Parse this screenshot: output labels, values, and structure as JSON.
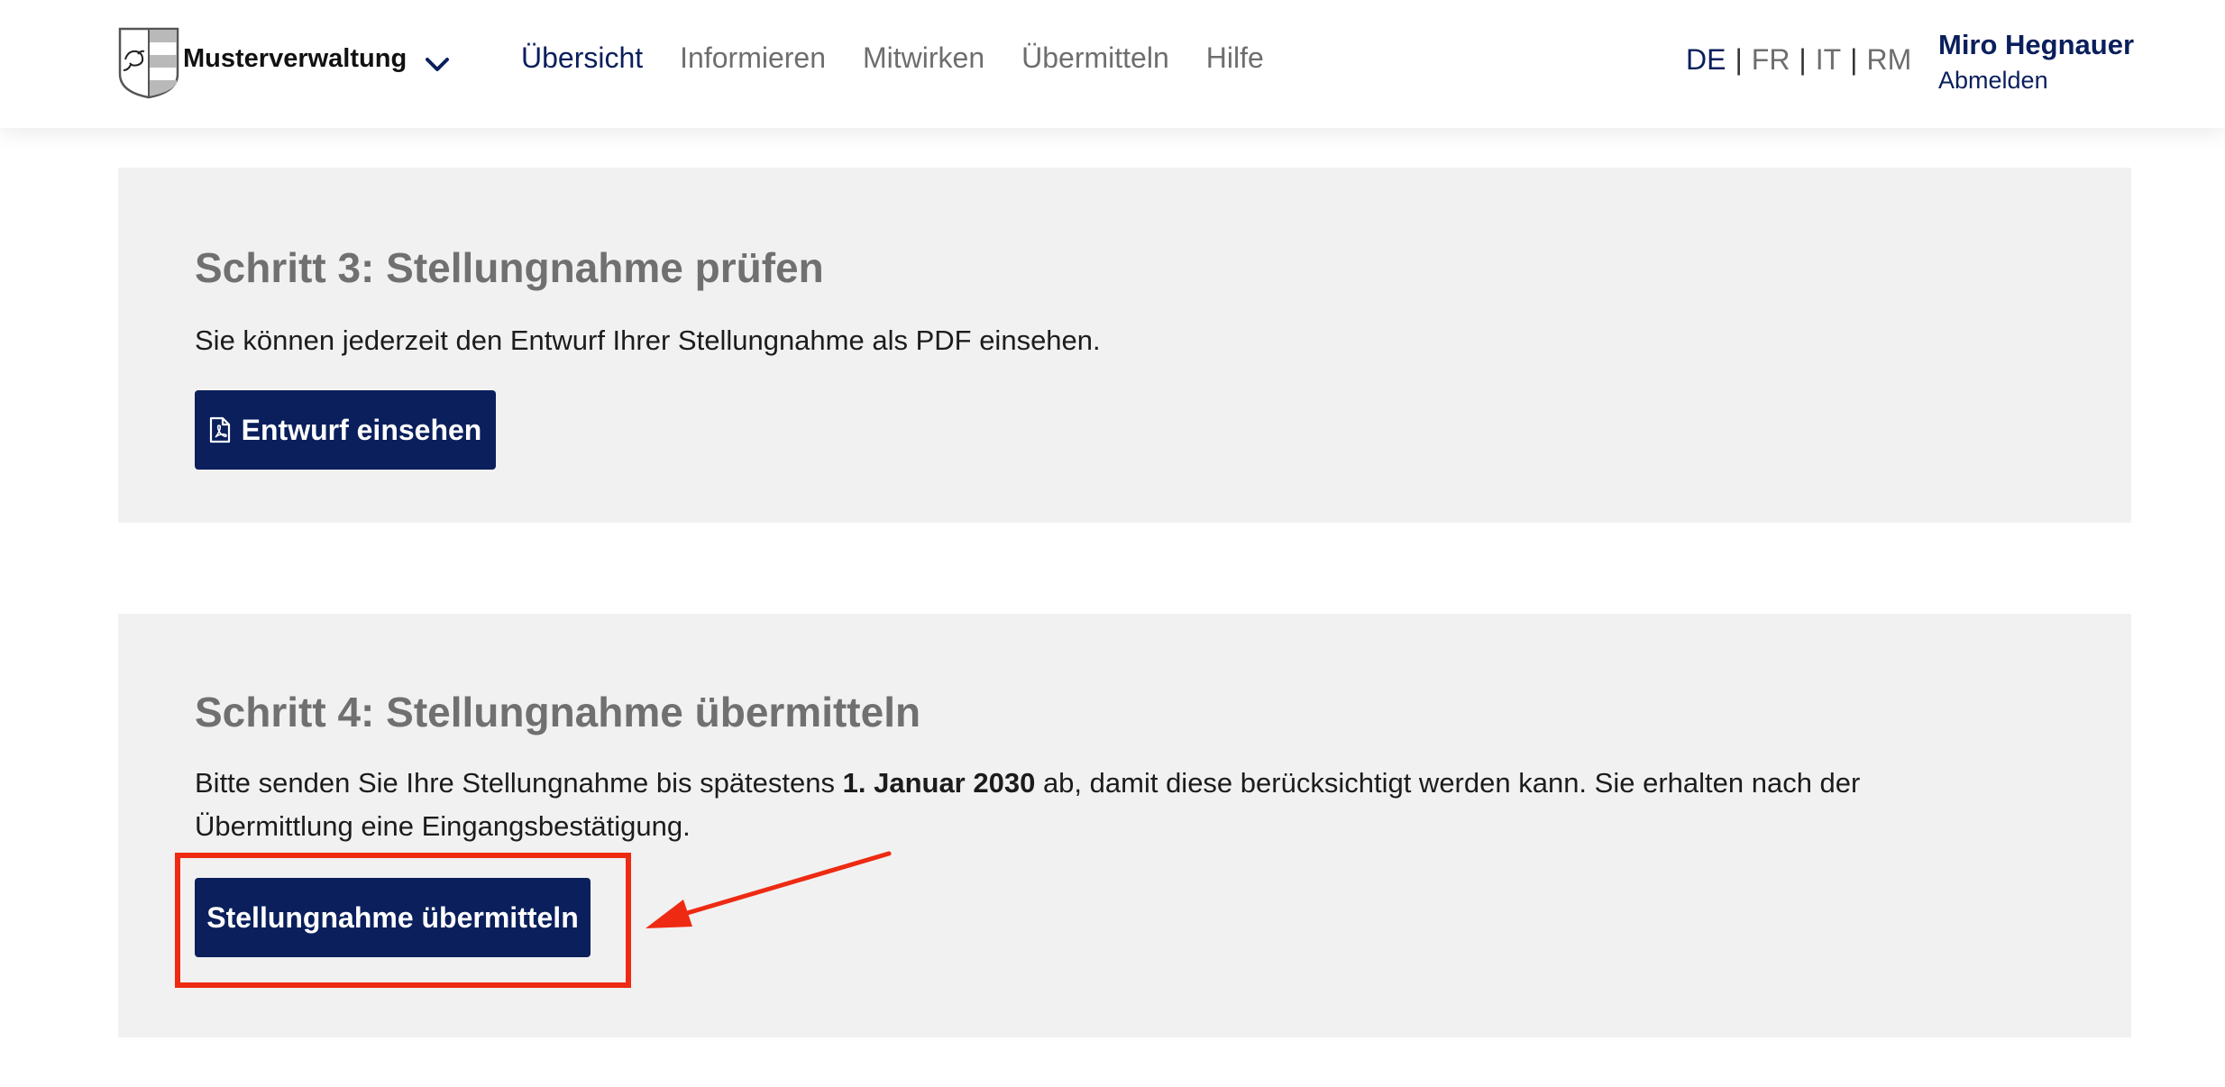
{
  "header": {
    "brand_name": "Musterverwaltung",
    "nav": [
      {
        "label": "Übersicht",
        "active": true
      },
      {
        "label": "Informieren",
        "active": false
      },
      {
        "label": "Mitwirken",
        "active": false
      },
      {
        "label": "Übermitteln",
        "active": false
      },
      {
        "label": "Hilfe",
        "active": false
      }
    ],
    "languages": [
      "DE",
      "FR",
      "IT",
      "RM"
    ],
    "active_language": "DE",
    "language_separator": "|",
    "user_name": "Miro Hegnauer",
    "logout_label": "Abmelden"
  },
  "step3": {
    "title": "Schritt 3: Stellungnahme prüfen",
    "text": "Sie können jederzeit den Entwurf Ihrer Stellungnahme als PDF einsehen.",
    "button_label": "Entwurf einsehen",
    "button_icon": "pdf-file-icon"
  },
  "step4": {
    "title": "Schritt 4: Stellungnahme übermitteln",
    "text_before": "Bitte senden Sie Ihre Stellungnahme bis spätestens ",
    "deadline": "1. Januar 2030",
    "text_after": " ab, damit diese berücksichtigt werden kann. Sie erhalten nach der Übermittlung eine Eingangsbestätigung.",
    "button_label": "Stellungnahme übermitteln"
  },
  "colors": {
    "primary": "#0a1f5c",
    "section_bg": "#f1f1f1",
    "muted_text": "#707070",
    "annotation": "#ee2a12"
  }
}
